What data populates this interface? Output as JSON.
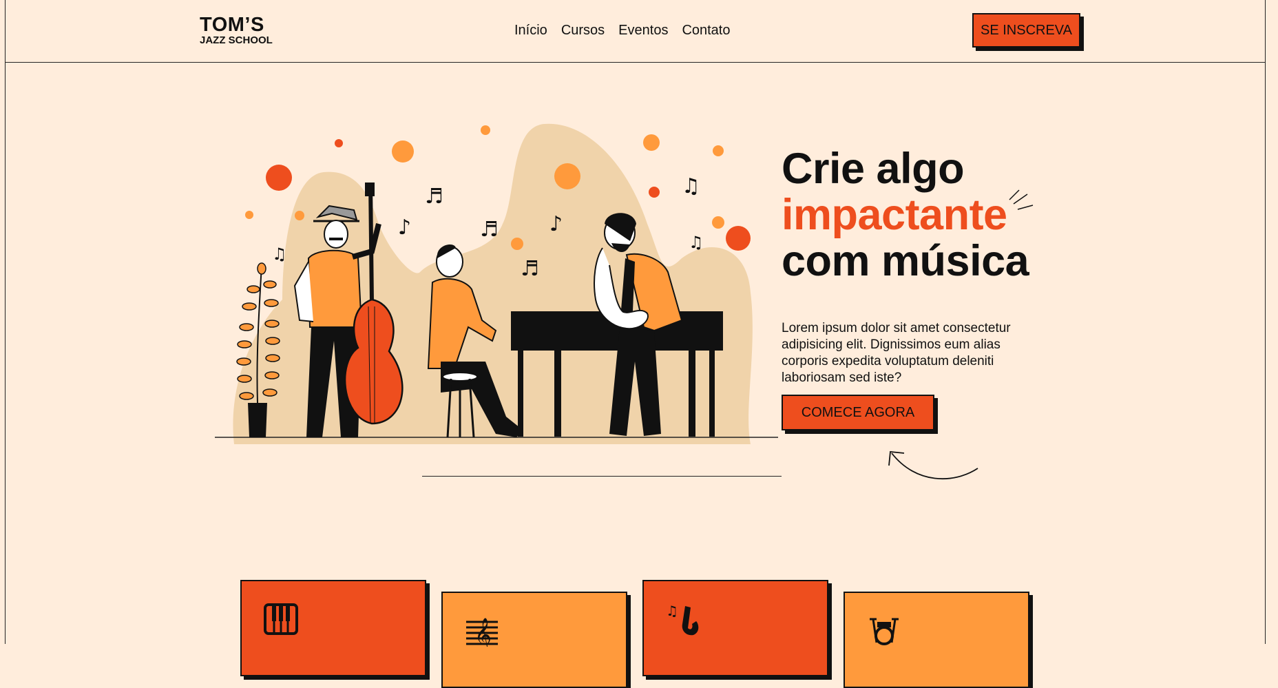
{
  "brand": {
    "name": "TOM’S",
    "subtitle": "JAZZ SCHOOL"
  },
  "nav": {
    "items": [
      "Início",
      "Cursos",
      "Eventos",
      "Contato"
    ]
  },
  "header": {
    "cta_label": "SE INSCREVA"
  },
  "hero": {
    "headline_line1": "Crie algo",
    "headline_accent": "impactante",
    "headline_line3": "com música",
    "description": "Lorem ipsum dolor sit amet consectetur adipisicing elit. Dignissimos eum alias corporis expedita voluptatum deleniti laboriosam sed iste?",
    "cta_label": "COMECE AGORA"
  },
  "cards": [
    {
      "icon": "piano-keys-icon",
      "color": "#ee4e1e"
    },
    {
      "icon": "sheet-music-icon",
      "color": "#ff9a3c"
    },
    {
      "icon": "saxophone-icon",
      "color": "#ee4e1e"
    },
    {
      "icon": "drum-kit-icon",
      "color": "#ff9a3c"
    }
  ],
  "colors": {
    "background": "#ffeddc",
    "accent": "#ee4e1e",
    "accent_light": "#ff9a3c",
    "blob": "#f0d3aa",
    "ink": "#111111"
  }
}
